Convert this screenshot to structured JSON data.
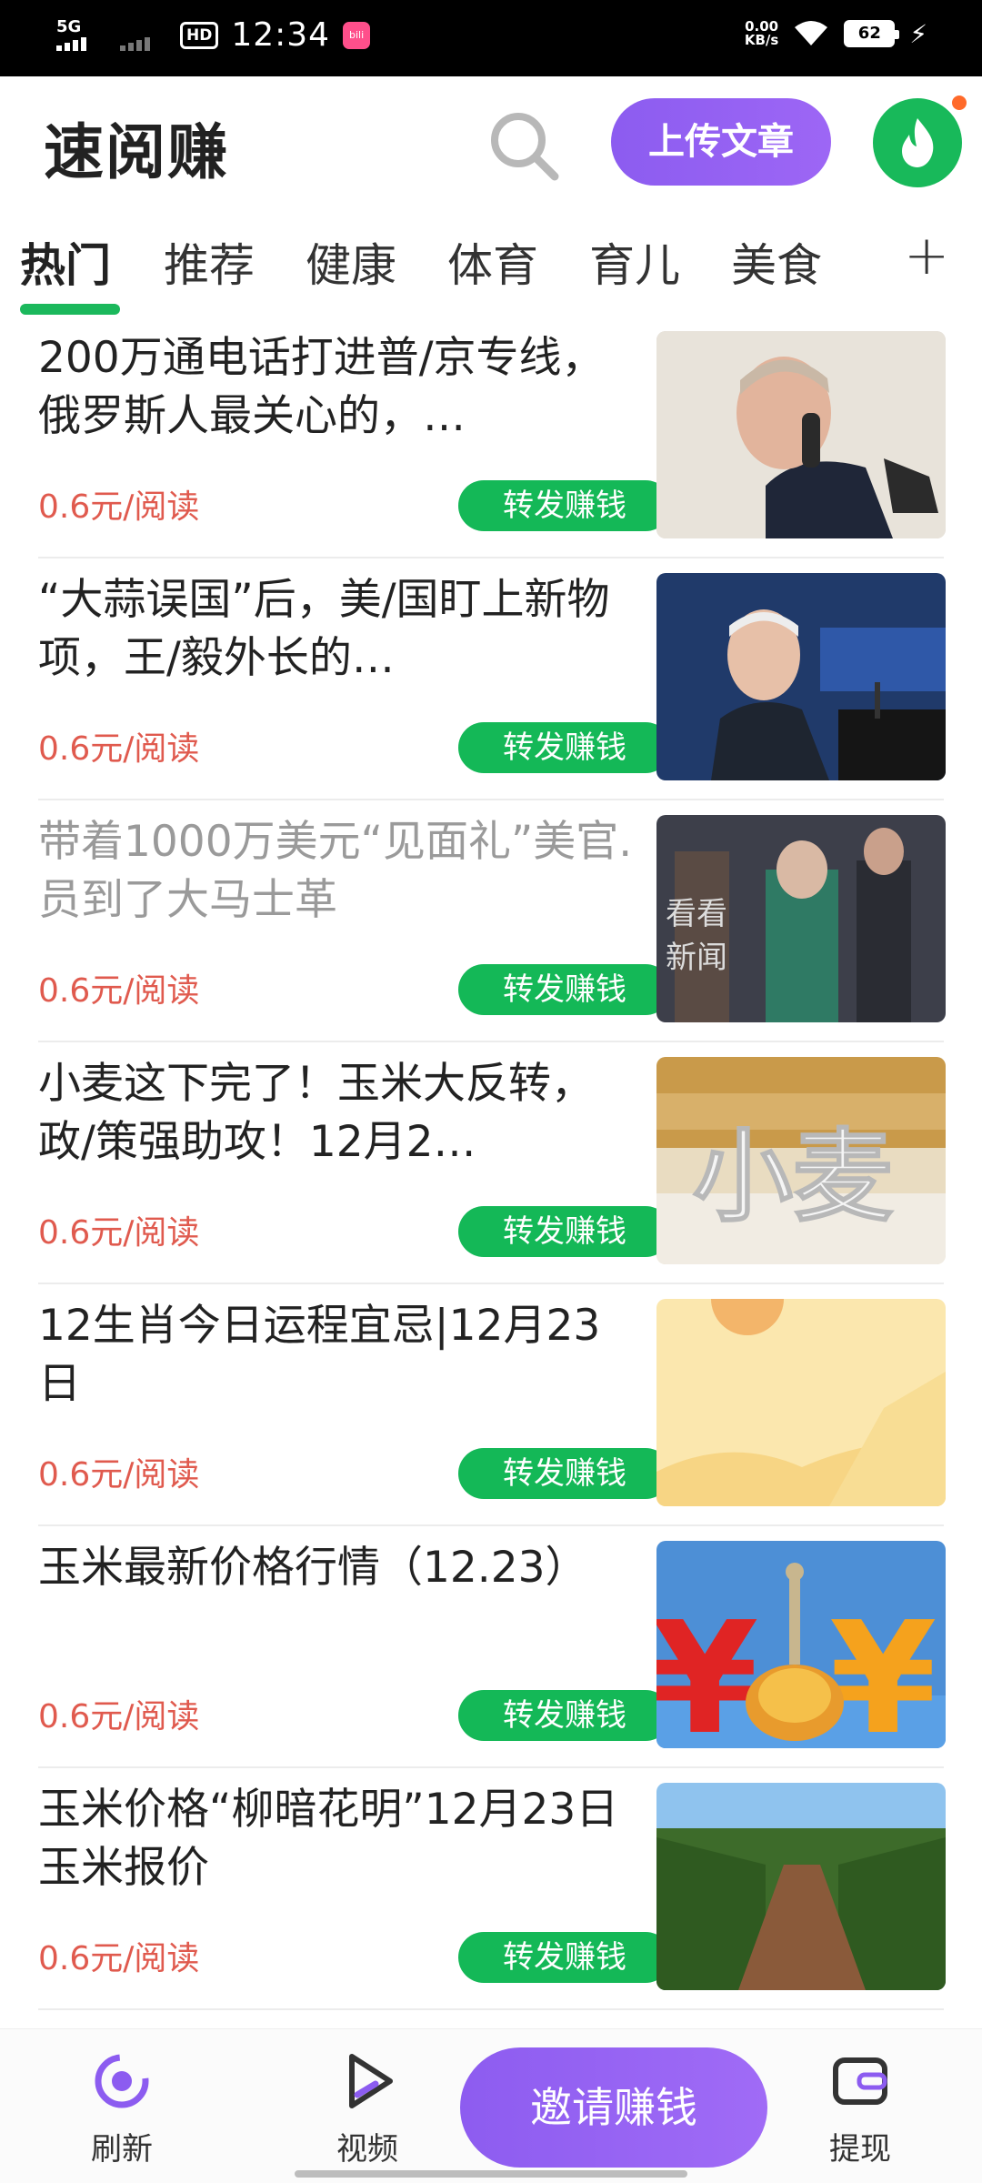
{
  "status_bar": {
    "network1": "5G",
    "hd": "HD",
    "time": "12:34",
    "app_icon_text": "bili",
    "net_speed_value": "0.00",
    "net_speed_unit": "KB/s",
    "battery": "62"
  },
  "header": {
    "title": "速阅赚",
    "upload_label": "上传文章"
  },
  "tabs": [
    {
      "label": "热门"
    },
    {
      "label": "推荐"
    },
    {
      "label": "健康"
    },
    {
      "label": "体育"
    },
    {
      "label": "育儿"
    },
    {
      "label": "美食"
    }
  ],
  "tab_plus": "+",
  "articles": [
    {
      "title": "200万通电话打进普/京专线，俄罗斯人最关心的，…",
      "price": "0.6元/阅读",
      "share": "转发赚钱"
    },
    {
      "title": "“大蒜误国”后，美/国盯上新物项，王/毅外长的…",
      "price": "0.6元/阅读",
      "share": "转发赚钱"
    },
    {
      "title": "带着1000万美元“见面礼”美官.员到了大马士革",
      "price": "0.6元/阅读",
      "share": "转发赚钱",
      "read": true
    },
    {
      "title": "小麦这下完了！玉米大反转，政/策强助攻！12月2…",
      "price": "0.6元/阅读",
      "share": "转发赚钱",
      "thumb_text": "小麦"
    },
    {
      "title": "12生肖今日运程宜忌|12月23日",
      "price": "0.6元/阅读",
      "share": "转发赚钱"
    },
    {
      "title": "玉米最新价格行情（12.23）",
      "price": "0.6元/阅读",
      "share": "转发赚钱"
    },
    {
      "title": "玉米价格“柳暗花明”12月23日玉米报价",
      "price": "0.6元/阅读",
      "share": "转发赚钱"
    }
  ],
  "thumb_texts": {
    "news_watermark_1": "看看",
    "news_watermark_2": "新闻",
    "wheat": "小麦"
  },
  "bottom_nav": {
    "refresh": "刷新",
    "video": "视频",
    "invite": "邀请赚钱",
    "withdraw": "提现"
  },
  "colors": {
    "accent_green": "#14b857",
    "accent_purple": "#8c5cf0",
    "price_red": "#e05a4e"
  }
}
